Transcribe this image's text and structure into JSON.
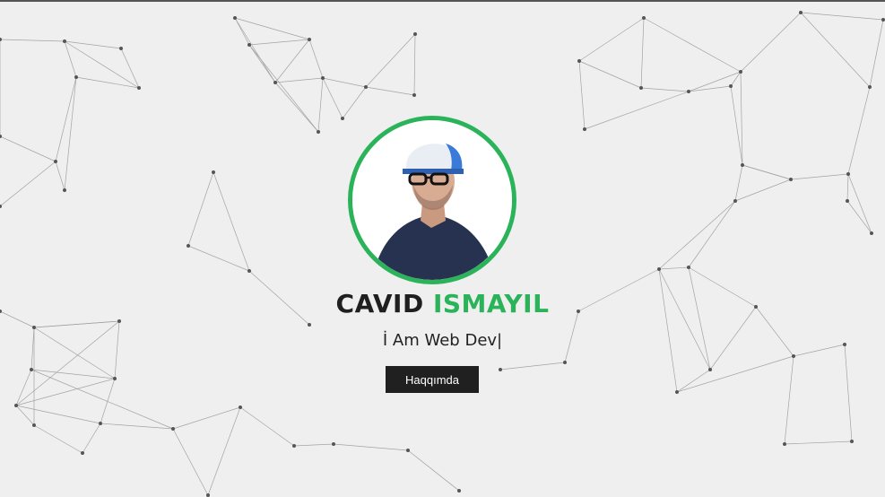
{
  "profile": {
    "first_name": "CAVID",
    "last_name": "ISMAYIL",
    "tagline": "İ Am Web Dev|",
    "avatar_icon": "profile-photo-icon"
  },
  "actions": {
    "about_label": "Haqqımda"
  },
  "colors": {
    "accent": "#2bb35a",
    "background": "#efefef",
    "button_bg": "#202020",
    "network_line": "#8a8a8a"
  }
}
